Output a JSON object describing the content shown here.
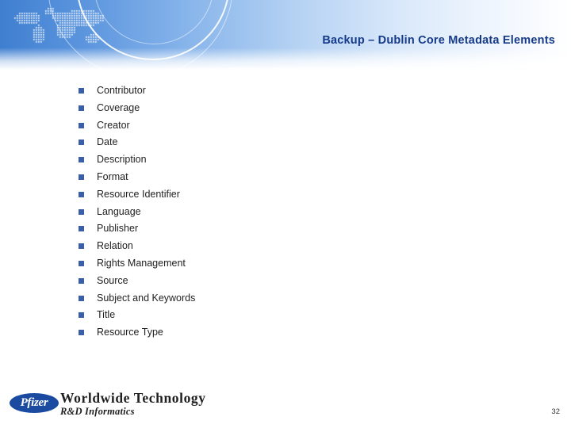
{
  "slide": {
    "title": "Backup – Dublin Core Metadata Elements",
    "page_number": "32",
    "bullet_marker_glyph": "■",
    "bullets": [
      {
        "text": "Contributor"
      },
      {
        "text": "Coverage"
      },
      {
        "text": "Creator"
      },
      {
        "text": "Date"
      },
      {
        "text": "Description"
      },
      {
        "text": "Format"
      },
      {
        "text": "Resource Identifier"
      },
      {
        "text": "Language"
      },
      {
        "text": "Publisher"
      },
      {
        "text": "Relation"
      },
      {
        "text": "Rights Management"
      },
      {
        "text": "Source"
      },
      {
        "text": "Subject and Keywords"
      },
      {
        "text": "Title"
      },
      {
        "text": "Resource Type"
      }
    ]
  },
  "footer": {
    "logo_text": "Pfizer",
    "org_line1": "Worldwide Technology",
    "org_line2": "R&D Informatics"
  },
  "colors": {
    "banner_blue": "#3f7fd0",
    "title_blue": "#153a8a",
    "bullet_blue": "#3a5fa8",
    "logo_blue": "#1b4ba0"
  }
}
